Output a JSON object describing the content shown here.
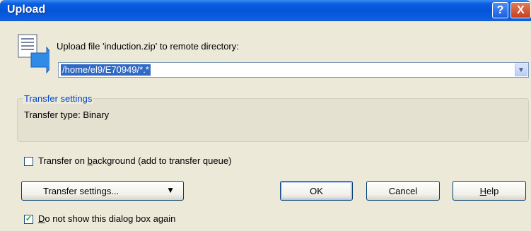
{
  "window": {
    "title": "Upload"
  },
  "titlebar": {
    "help_glyph": "?",
    "close_glyph": "X"
  },
  "upload": {
    "label": "Upload file 'induction.zip' to remote directory:",
    "directory_value": "/home/el9/E70949/*.*",
    "icon": "upload-arrow-icon"
  },
  "transfer_settings_group": {
    "title": "Transfer settings",
    "transfer_type": "Transfer type: Binary"
  },
  "background_checkbox": {
    "label_pre": "Transfer on ",
    "label_key": "b",
    "label_post": "ackground (add to transfer queue)",
    "checked": false
  },
  "buttons": {
    "transfer_settings": "Transfer settings...",
    "ok": "OK",
    "cancel": "Cancel",
    "help_key": "H",
    "help_rest": "elp"
  },
  "dont_show_checkbox": {
    "label_key": "D",
    "label_rest": "o not show this dialog box again",
    "checked": true,
    "check_glyph": "✓"
  }
}
